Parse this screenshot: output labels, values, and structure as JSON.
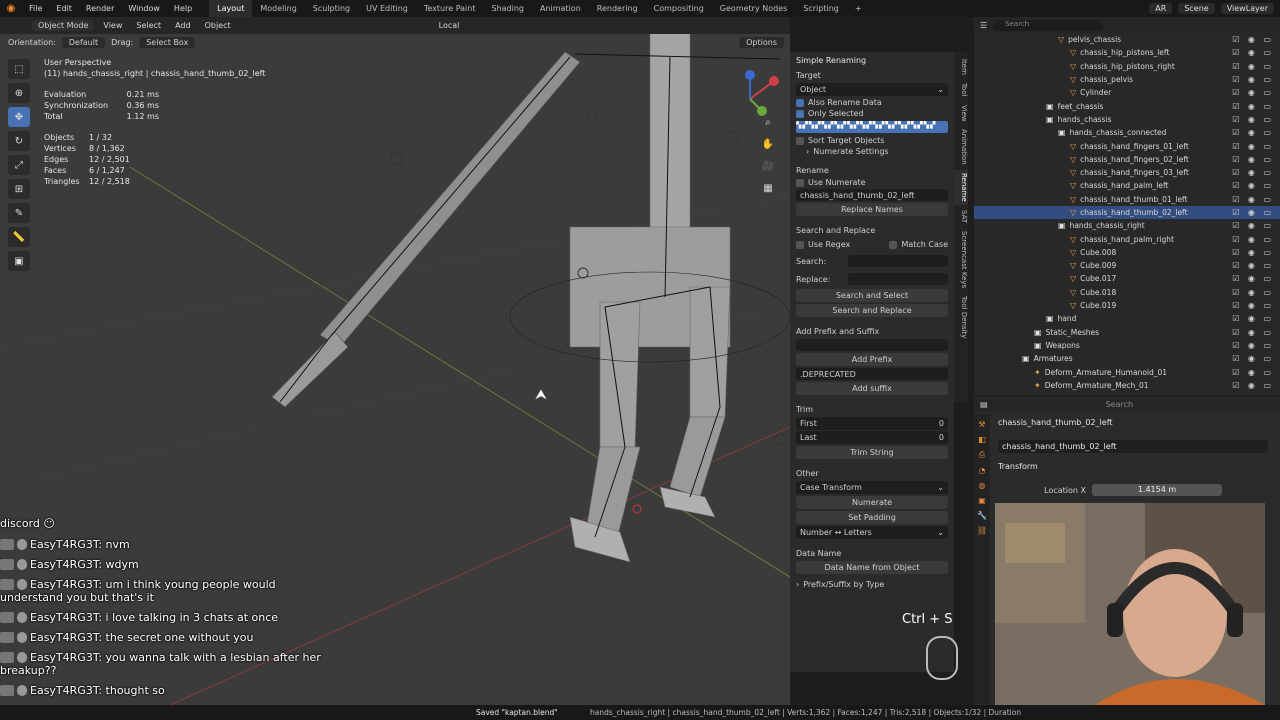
{
  "topbar": {
    "menus": [
      "File",
      "Edit",
      "Render",
      "Window",
      "Help"
    ],
    "workspaces": [
      "Layout",
      "Modeling",
      "Sculpting",
      "UV Editing",
      "Texture Paint",
      "Shading",
      "Animation",
      "Rendering",
      "Compositing",
      "Geometry Nodes",
      "Scripting"
    ],
    "active_workspace": "Layout",
    "scene": "Scene",
    "view_layer": "ViewLayer",
    "ar_label": "AR"
  },
  "viewport": {
    "mode": "Object Mode",
    "menus": [
      "View",
      "Select",
      "Add",
      "Object"
    ],
    "transform_orientation": "Local",
    "orientation_label": "Orientation:",
    "orientation_value": "Default",
    "drag_label": "Drag:",
    "drag_value": "Select Box",
    "options": "Options",
    "perspective": "User Perspective",
    "active_object_line": "(11) hands_chassis_right | chassis_hand_thumb_02_left",
    "timing": [
      {
        "k": "Evaluation",
        "v": "0.21 ms"
      },
      {
        "k": "Synchronization",
        "v": "0.36 ms"
      },
      {
        "k": "Total",
        "v": "1.12 ms"
      }
    ],
    "stats": [
      {
        "k": "Objects",
        "v": "1 / 32"
      },
      {
        "k": "Vertices",
        "v": "8 / 1,362"
      },
      {
        "k": "Edges",
        "v": "12 / 2,501"
      },
      {
        "k": "Faces",
        "v": "6 / 1,247"
      },
      {
        "k": "Triangles",
        "v": "12 / 2,518"
      }
    ]
  },
  "npanel": {
    "title": "Simple Renaming",
    "target_label": "Target",
    "target_value": "Object",
    "also_rename_data": "Also Rename Data",
    "only_selected": "Only Selected",
    "sort_target_objects": "Sort Target Objects",
    "numerate_settings": "Numerate Settings",
    "rename_label": "Rename",
    "use_numerate": "Use Numerate",
    "rename_value": "chassis_hand_thumb_02_left",
    "replace_names": "Replace Names",
    "search_replace_label": "Search and Replace",
    "use_regex": "Use Regex",
    "match_case": "Match Case",
    "search_label": "Search:",
    "replace_label": "Replace:",
    "search_and_select": "Search and Select",
    "search_and_replace": "Search and Replace",
    "prefix_suffix_label": "Add Prefix and Suffix",
    "add_prefix": "Add Prefix",
    "suffix_value": ".DEPRECATED",
    "add_suffix": "Add suffix",
    "trim_label": "Trim",
    "first_label": "First",
    "first_value": "0",
    "last_label": "Last",
    "last_value": "0",
    "trim_string": "Trim String",
    "other_label": "Other",
    "case_transform": "Case Transform",
    "numerate": "Numerate",
    "set_padding": "Set Padding",
    "number_letters": "Number ↔ Letters",
    "data_name_label": "Data Name",
    "data_name_from_object": "Data Name from Object",
    "prefix_suffix_by_type": "Prefix/Suffix by Type",
    "tabs": [
      "Item",
      "Tool",
      "View",
      "Animation",
      "Rename",
      "SAT",
      "Screencast Keys",
      "Tool Density"
    ]
  },
  "outliner": {
    "search_placeholder": "Search",
    "rows": [
      {
        "indent": 84,
        "label": "pelvis_chassis",
        "type": "obj",
        "sel": false
      },
      {
        "indent": 96,
        "label": "chassis_hip_pistons_left",
        "type": "obj",
        "sel": false
      },
      {
        "indent": 96,
        "label": "chassis_hip_pistons_right",
        "type": "obj",
        "sel": false
      },
      {
        "indent": 96,
        "label": "chassis_pelvis",
        "type": "obj",
        "sel": false
      },
      {
        "indent": 96,
        "label": "Cylinder",
        "type": "obj",
        "sel": false
      },
      {
        "indent": 72,
        "label": "feet_chassis",
        "type": "col",
        "sel": false
      },
      {
        "indent": 72,
        "label": "hands_chassis",
        "type": "col",
        "sel": false
      },
      {
        "indent": 84,
        "label": "hands_chassis_connected",
        "type": "col",
        "sel": false
      },
      {
        "indent": 96,
        "label": "chassis_hand_fingers_01_left",
        "type": "obj",
        "sel": false
      },
      {
        "indent": 96,
        "label": "chassis_hand_fingers_02_left",
        "type": "obj",
        "sel": false
      },
      {
        "indent": 96,
        "label": "chassis_hand_fingers_03_left",
        "type": "obj",
        "sel": false
      },
      {
        "indent": 96,
        "label": "chassis_hand_palm_left",
        "type": "obj",
        "sel": false
      },
      {
        "indent": 96,
        "label": "chassis_hand_thumb_01_left",
        "type": "obj",
        "sel": false
      },
      {
        "indent": 96,
        "label": "chassis_hand_thumb_02_left",
        "type": "obj",
        "sel": true
      },
      {
        "indent": 84,
        "label": "hands_chassis_right",
        "type": "col",
        "sel": false
      },
      {
        "indent": 96,
        "label": "chassis_hand_palm_right",
        "type": "obj",
        "sel": false
      },
      {
        "indent": 96,
        "label": "Cube.008",
        "type": "obj",
        "sel": false
      },
      {
        "indent": 96,
        "label": "Cube.009",
        "type": "obj",
        "sel": false
      },
      {
        "indent": 96,
        "label": "Cube.017",
        "type": "obj",
        "sel": false
      },
      {
        "indent": 96,
        "label": "Cube.018",
        "type": "obj",
        "sel": false
      },
      {
        "indent": 96,
        "label": "Cube.019",
        "type": "obj",
        "sel": false
      },
      {
        "indent": 72,
        "label": "hand",
        "type": "col",
        "sel": false
      },
      {
        "indent": 60,
        "label": "Static_Meshes",
        "type": "col",
        "sel": false
      },
      {
        "indent": 60,
        "label": "Weapons",
        "type": "col",
        "sel": false
      },
      {
        "indent": 48,
        "label": "Armatures",
        "type": "col",
        "sel": false
      },
      {
        "indent": 60,
        "label": "Deform_Armature_Humanoid_01",
        "type": "arm",
        "sel": false
      },
      {
        "indent": 60,
        "label": "Deform_Armature_Mech_01",
        "type": "arm",
        "sel": false
      }
    ]
  },
  "properties": {
    "search_placeholder": "Search",
    "object_header": "chassis_hand_thumb_02_left",
    "object_name": "chassis_hand_thumb_02_left",
    "transform_label": "Transform",
    "location_x_label": "Location X",
    "location_x_value": "1.4154 m"
  },
  "chat": [
    {
      "user": "EasyT4RG3T",
      "msg": "nvm"
    },
    {
      "user": "EasyT4RG3T",
      "msg": "wdym"
    },
    {
      "user": "EasyT4RG3T",
      "msg": "um i think young people would understand you but that's it"
    },
    {
      "user": "EasyT4RG3T",
      "msg": "i love talking in 3 chats at once"
    },
    {
      "user": "EasyT4RG3T",
      "msg": "the secret one without you"
    },
    {
      "user": "EasyT4RG3T",
      "msg": "you wanna talk with a lesbian after her breakup??"
    },
    {
      "user": "EasyT4RG3T",
      "msg": "thought so"
    }
  ],
  "chat_partial_top": "discord",
  "key_hint": "Ctrl + S",
  "statusbar": {
    "saved": "Saved \"kaptan.blend\"",
    "info": "hands_chassis_right | chassis_hand_thumb_02_left | Verts:1,362 | Faces:1,247 | Tris:2,518 | Objects:1/32 | Duration"
  }
}
